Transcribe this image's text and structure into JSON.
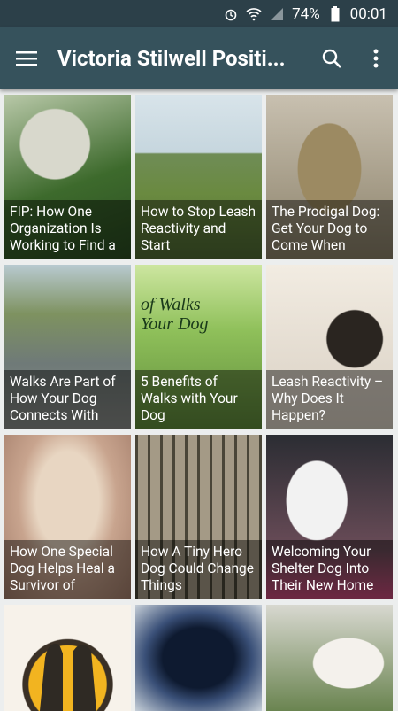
{
  "status_bar": {
    "battery": "74%",
    "time": "00:01"
  },
  "app_bar": {
    "title": "Victoria Stilwell Positi..."
  },
  "tiles": [
    {
      "caption": "FIP: How One Organization Is Working to Find a"
    },
    {
      "caption": "How to Stop Leash Reactivity and Start"
    },
    {
      "caption": "The Prodigal Dog: Get Your Dog to Come When"
    },
    {
      "caption": "Walks Are Part of How Your Dog Connects With"
    },
    {
      "caption": "5 Benefits of Walks with Your Dog"
    },
    {
      "caption": "Leash Reactivity – Why Does It Happen?"
    },
    {
      "caption": "How One Special Dog Helps Heal a Survivor of"
    },
    {
      "caption": "How A Tiny Hero Dog Could Change Things"
    },
    {
      "caption": "Welcoming Your Shelter Dog Into Their New Home"
    }
  ],
  "tile5_overlay_text": "of Walks\nYour Dog"
}
